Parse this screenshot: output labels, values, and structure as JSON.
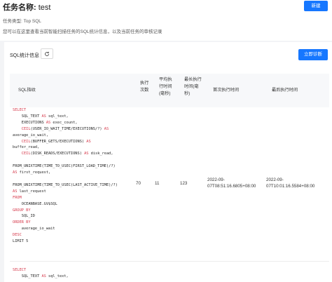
{
  "header": {
    "title_label": "任务名称:",
    "title_value": "test",
    "new_button": "新建",
    "task_type": "任务类型: Top SQL",
    "description": "您可以在这里查看当前智能扫描任务的SQL统计信息，以及当前任务的审核记录"
  },
  "card": {
    "title": "SQL统计信息",
    "diagnose_button": "立即诊断",
    "columns": [
      "SQL指纹",
      "执行次数",
      "平均执行时间(毫秒)",
      "最长执行时间(毫秒)",
      "首次执行时间",
      "最后执行时间"
    ],
    "rows": [
      {
        "sql_lines": [
          [
            {
              "t": "SELECT",
              "k": "kw"
            }
          ],
          [
            {
              "t": "    SQL_TEXT "
            },
            {
              "t": "AS",
              "k": "kw"
            },
            {
              "t": " sql_text,"
            }
          ],
          [
            {
              "t": "    EXECUTIONS "
            },
            {
              "t": "AS",
              "k": "kw"
            },
            {
              "t": " exec_count,"
            }
          ],
          [
            {
              "t": "    "
            },
            {
              "t": "CEIL",
              "k": "fn"
            },
            {
              "t": "(USER_IO_WAIT_TIME/EXECUTIONS/?) "
            },
            {
              "t": "AS",
              "k": "kw"
            }
          ],
          [
            {
              "t": "average_io_wait,"
            }
          ],
          [
            {
              "t": "    "
            },
            {
              "t": "CEIL",
              "k": "fn"
            },
            {
              "t": "(BUFFER_GETS/EXECUTIONS) "
            },
            {
              "t": "AS",
              "k": "kw"
            }
          ],
          [
            {
              "t": "buffer_read,"
            }
          ],
          [
            {
              "t": "    "
            },
            {
              "t": "CEIL",
              "k": "fn"
            },
            {
              "t": "(DISK_READS/EXECUTIONS) "
            },
            {
              "t": "AS",
              "k": "kw"
            },
            {
              "t": " disk_read,"
            }
          ],
          [
            {
              "t": ""
            }
          ],
          [
            {
              "t": "FROM_UNIXTIME(TIME_TO_USEC(FIRST_LOAD_TIME)/?)"
            }
          ],
          [
            {
              "t": "AS",
              "k": "kw"
            },
            {
              "t": " first_request,"
            }
          ],
          [
            {
              "t": ""
            }
          ],
          [
            {
              "t": "FROM_UNIXTIME(TIME_TO_USEC(LAST_ACTIVE_TIME)/?)"
            }
          ],
          [
            {
              "t": "AS",
              "k": "kw"
            },
            {
              "t": " last_request"
            }
          ],
          [
            {
              "t": "FROM",
              "k": "kw"
            }
          ],
          [
            {
              "t": "    OCEANBASE.GV$SQL"
            }
          ],
          [
            {
              "t": "GROUP BY",
              "k": "kw"
            }
          ],
          [
            {
              "t": "    SQL_ID"
            }
          ],
          [
            {
              "t": "ORDER BY",
              "k": "kw"
            }
          ],
          [
            {
              "t": "    average_io_wait"
            }
          ],
          [
            {
              "t": "DESC",
              "k": "kw"
            }
          ],
          [
            {
              "t": "LIMIT 5"
            }
          ]
        ],
        "exec_count": "70",
        "avg_time": "11",
        "max_time": "123",
        "first_time_line1": "2022-09-",
        "first_time_line2": "07T08:51:16.6805+08:00",
        "last_time_line1": "2022-09-",
        "last_time_line2": "07T10:01:16.5584+08:00"
      },
      {
        "sql_lines": [
          [
            {
              "t": "SELECT",
              "k": "kw"
            }
          ],
          [
            {
              "t": "    SQL_TEXT "
            },
            {
              "t": "AS",
              "k": "kw"
            },
            {
              "t": " sql_text,"
            }
          ]
        ]
      }
    ]
  }
}
